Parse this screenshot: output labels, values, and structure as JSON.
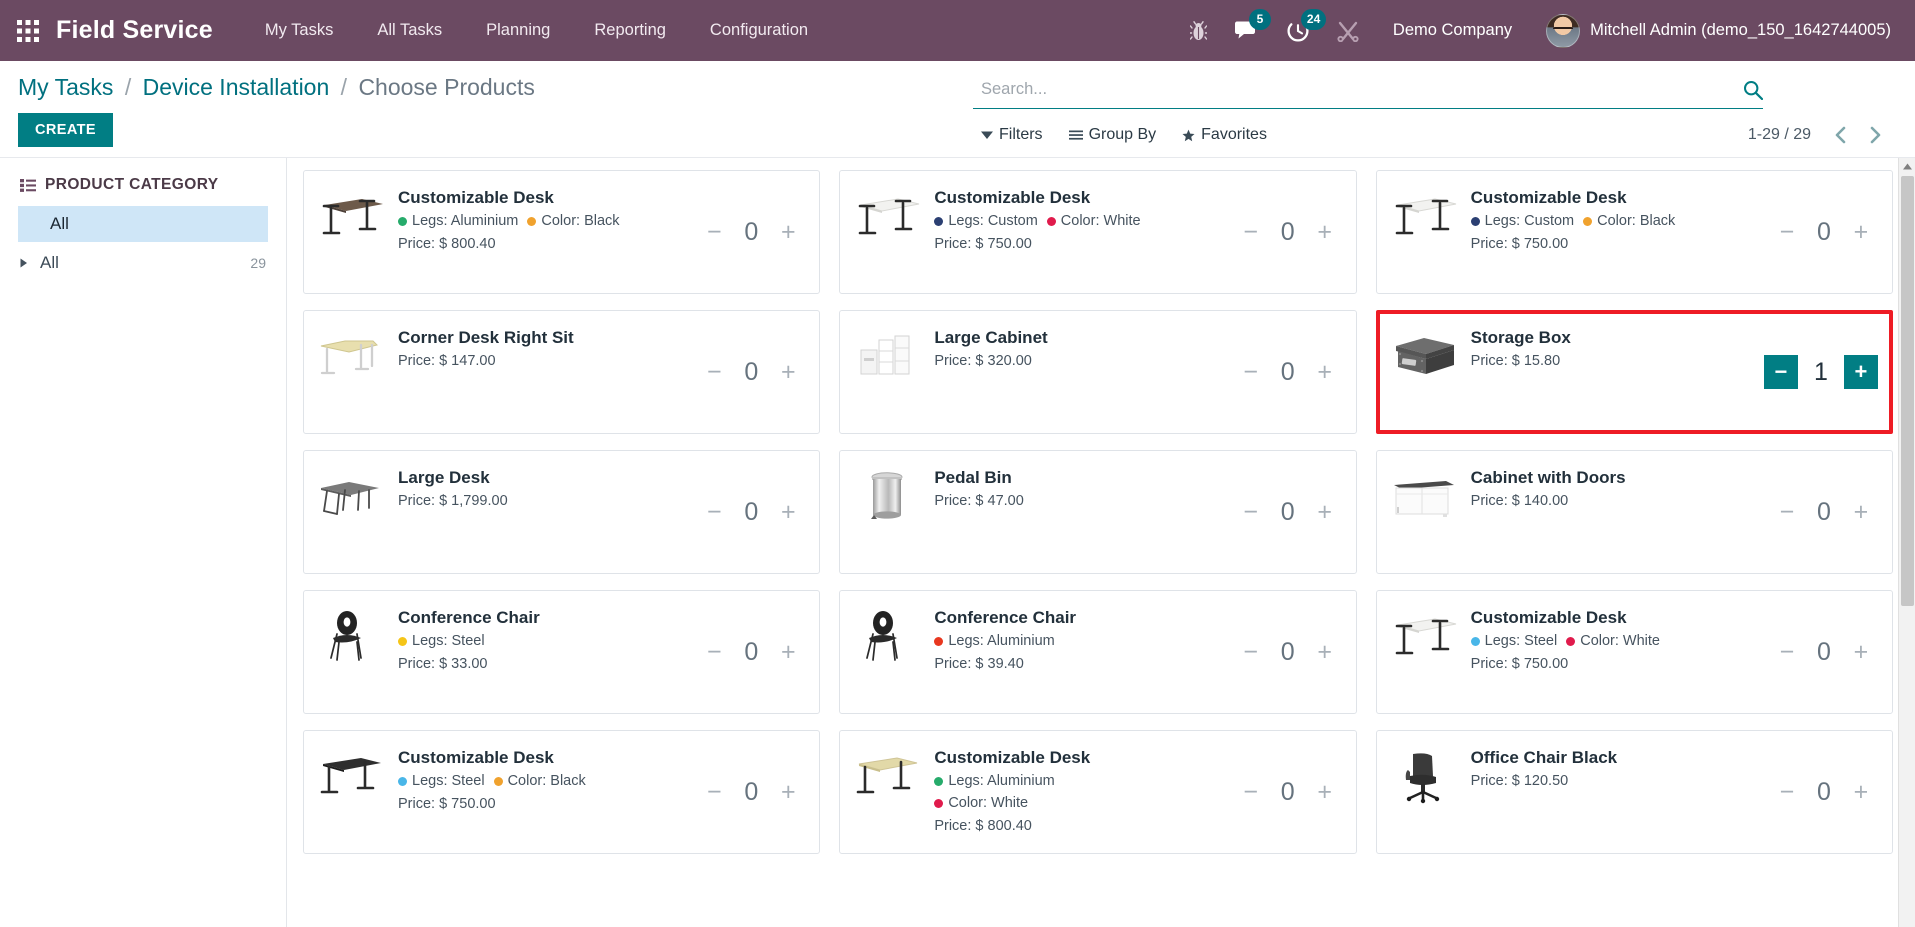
{
  "navbar": {
    "apps_icon": "apps-grid-icon",
    "brand": "Field Service",
    "menu": [
      {
        "label": "My Tasks"
      },
      {
        "label": "All Tasks"
      },
      {
        "label": "Planning"
      },
      {
        "label": "Reporting"
      },
      {
        "label": "Configuration"
      }
    ],
    "bug_icon": "bug-icon",
    "messages_icon": "chat-bubble-icon",
    "messages_count": "5",
    "activities_icon": "clock-activity-icon",
    "activities_count": "24",
    "tools_icon": "tools-icon",
    "company": "Demo Company",
    "user": "Mitchell Admin (demo_150_1642744005)",
    "accent_color": "#6b4a62",
    "badge_color": "#00707f"
  },
  "control_panel": {
    "breadcrumb": [
      {
        "label": "My Tasks",
        "active": false
      },
      {
        "label": "Device Installation",
        "active": false
      },
      {
        "label": "Choose Products",
        "active": true
      }
    ],
    "separator": "/",
    "create_label": "CREATE",
    "search": {
      "value": "",
      "placeholder": "Search...",
      "icon": "search-icon"
    },
    "filters": [
      {
        "label": "Filters",
        "icon": "filter-caret-icon"
      },
      {
        "label": "Group By",
        "icon": "group-by-icon"
      },
      {
        "label": "Favorites",
        "icon": "star-icon"
      }
    ],
    "pager": {
      "range": "1-29 / 29",
      "prev_icon": "chevron-left-icon",
      "next_icon": "chevron-right-icon"
    }
  },
  "sidebar": {
    "title": "PRODUCT CATEGORY",
    "title_icon": "list-icon",
    "selected_item": "All",
    "rows": [
      {
        "label": "All",
        "count": "29",
        "caret": "caret-right-icon"
      }
    ]
  },
  "products": [
    {
      "name": "Customizable Desk",
      "attrs": [
        {
          "label": "Legs: Aluminium",
          "color": "#26ab6b"
        },
        {
          "label": "Color: Black",
          "color": "#f0a22e"
        }
      ],
      "price": "Price: $ 800.40",
      "qty": "0",
      "selected": false,
      "thumb": "desk-dark-top"
    },
    {
      "name": "Customizable Desk",
      "attrs": [
        {
          "label": "Legs: Custom",
          "color": "#2b3f72"
        },
        {
          "label": "Color: White",
          "color": "#e01b4c"
        }
      ],
      "price": "Price: $ 750.00",
      "qty": "0",
      "selected": false,
      "thumb": "desk-white-top"
    },
    {
      "name": "Customizable Desk",
      "attrs": [
        {
          "label": "Legs: Custom",
          "color": "#2b3f72"
        },
        {
          "label": "Color: Black",
          "color": "#f0a22e"
        }
      ],
      "price": "Price: $ 750.00",
      "qty": "0",
      "selected": false,
      "thumb": "desk-white-top"
    },
    {
      "name": "Corner Desk Right Sit",
      "attrs": [],
      "price": "Price: $ 147.00",
      "qty": "0",
      "selected": false,
      "thumb": "corner-desk"
    },
    {
      "name": "Large Cabinet",
      "attrs": [],
      "price": "Price: $ 320.00",
      "qty": "0",
      "selected": false,
      "thumb": "large-cabinet"
    },
    {
      "name": "Storage Box",
      "attrs": [],
      "price": "Price: $ 15.80",
      "qty": "1",
      "selected": true,
      "thumb": "storage-box"
    },
    {
      "name": "Large Desk",
      "attrs": [],
      "price": "Price: $ 1,799.00",
      "qty": "0",
      "selected": false,
      "thumb": "large-desk"
    },
    {
      "name": "Pedal Bin",
      "attrs": [],
      "price": "Price: $ 47.00",
      "qty": "0",
      "selected": false,
      "thumb": "pedal-bin"
    },
    {
      "name": "Cabinet with Doors",
      "attrs": [],
      "price": "Price: $ 140.00",
      "qty": "0",
      "selected": false,
      "thumb": "cabinet-doors"
    },
    {
      "name": "Conference Chair",
      "attrs": [
        {
          "label": "Legs: Steel",
          "color": "#f5c518"
        }
      ],
      "price": "Price: $ 33.00",
      "qty": "0",
      "selected": false,
      "thumb": "conference-chair"
    },
    {
      "name": "Conference Chair",
      "attrs": [
        {
          "label": "Legs: Aluminium",
          "color": "#e8371f"
        }
      ],
      "price": "Price: $ 39.40",
      "qty": "0",
      "selected": false,
      "thumb": "conference-chair"
    },
    {
      "name": "Customizable Desk",
      "attrs": [
        {
          "label": "Legs: Steel",
          "color": "#49b6e8"
        },
        {
          "label": "Color: White",
          "color": "#e01b4c"
        }
      ],
      "price": "Price: $ 750.00",
      "qty": "0",
      "selected": false,
      "thumb": "desk-white-top"
    },
    {
      "name": "Customizable Desk",
      "attrs": [
        {
          "label": "Legs: Steel",
          "color": "#49b6e8"
        },
        {
          "label": "Color: Black",
          "color": "#f0a22e"
        }
      ],
      "price": "Price: $ 750.00",
      "qty": "0",
      "selected": false,
      "thumb": "desk-black-top"
    },
    {
      "name": "Customizable Desk",
      "attrs": [
        {
          "label": "Legs: Aluminium",
          "color": "#26ab6b"
        },
        {
          "label": "Color: White",
          "color": "#e01b4c"
        }
      ],
      "price": "Price: $ 800.40",
      "qty": "0",
      "selected": false,
      "thumb": "desk-beige-top",
      "stacked_attrs": true
    },
    {
      "name": "Office Chair Black",
      "attrs": [],
      "price": "Price: $ 120.50",
      "qty": "0",
      "selected": false,
      "thumb": "office-chair"
    }
  ],
  "stepper": {
    "minus": "−",
    "plus": "+"
  },
  "scrollbar": {
    "up_icon": "scroll-up-icon",
    "down_icon": "scroll-down-icon"
  }
}
